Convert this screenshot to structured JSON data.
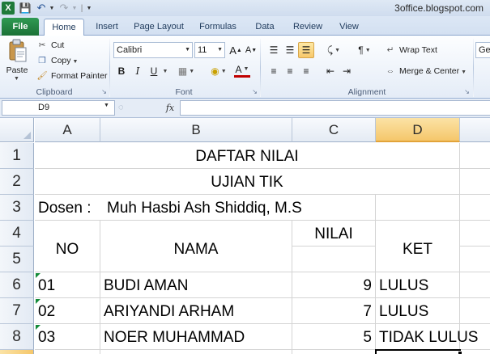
{
  "app": {
    "logo": "X",
    "window_title": "3office.blogspot.com"
  },
  "quick_access": {
    "save_icon": "save-icon",
    "undo_icon": "undo-icon",
    "redo_icon": "redo-icon"
  },
  "tabs": [
    "File",
    "Home",
    "Insert",
    "Page Layout",
    "Formulas",
    "Data",
    "Review",
    "View"
  ],
  "ribbon": {
    "clipboard": {
      "label": "Clipboard",
      "paste": "Paste",
      "cut": "Cut",
      "copy": "Copy",
      "format_painter": "Format Painter"
    },
    "font": {
      "label": "Font",
      "font_name": "Calibri",
      "font_size": "11",
      "grow": "A",
      "shrink": "A",
      "bold": "B",
      "italic": "I",
      "underline": "U",
      "font_color_glyph": "A"
    },
    "alignment": {
      "label": "Alignment",
      "wrap_text": "Wrap Text",
      "merge_center": "Merge & Center"
    },
    "number": {
      "format_partial": "Ger"
    }
  },
  "formula_bar": {
    "name_box": "D9",
    "fx": "fx",
    "formula": ""
  },
  "sheet": {
    "columns": [
      "A",
      "B",
      "C",
      "D"
    ],
    "rows": [
      "1",
      "2",
      "3",
      "4",
      "5",
      "6",
      "7",
      "8"
    ],
    "title": "DAFTAR NILAI",
    "subtitle": "UJIAN TIK",
    "dosen_label": "Dosen :",
    "dosen_name": "Muh Hasbi Ash Shiddiq, M.S",
    "headers": {
      "no": "NO",
      "nama": "NAMA",
      "nilai": "NILAI",
      "ket": "KET"
    },
    "records": [
      {
        "no": "01",
        "nama": "BUDI AMAN",
        "nilai": "9",
        "ket": "LULUS"
      },
      {
        "no": "02",
        "nama": "ARIYANDI ARHAM",
        "nilai": "7",
        "ket": "LULUS"
      },
      {
        "no": "03",
        "nama": "NOER MUHAMMAD",
        "nilai": "5",
        "ket": "TIDAK LULUS"
      }
    ]
  },
  "colors": {
    "file_tab": "#1f7a3a",
    "selection": "#f5c76b",
    "error_marker": "#138a38"
  }
}
